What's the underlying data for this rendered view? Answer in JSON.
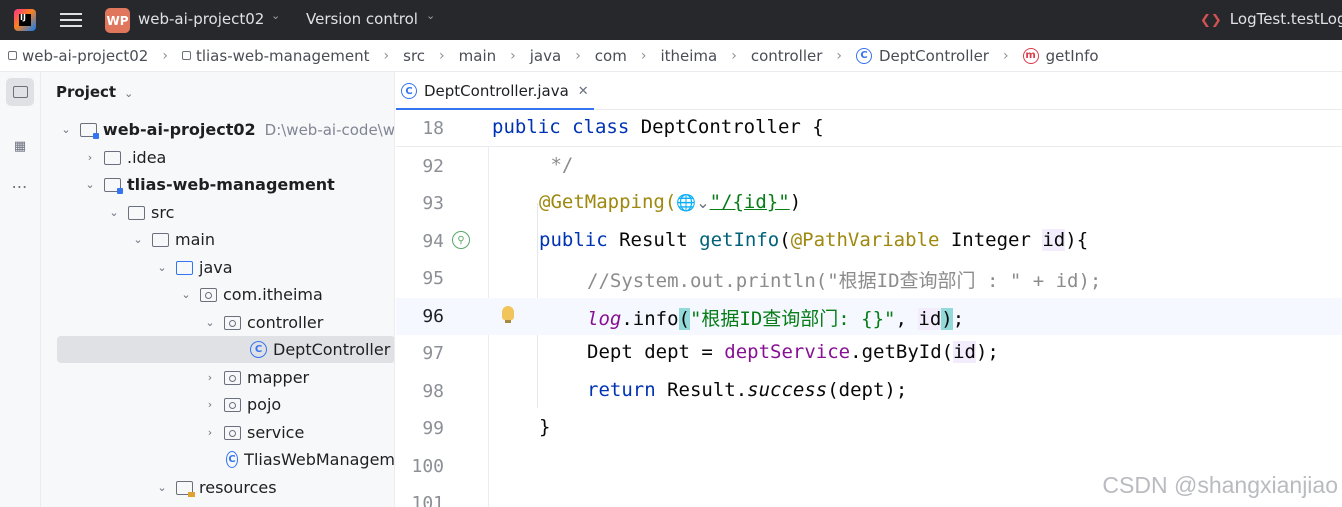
{
  "titlebar": {
    "project_badge": "WP",
    "project_name": "web-ai-project02",
    "vcs_label": "Version control",
    "run_config": "LogTest.testLog"
  },
  "breadcrumb": [
    "web-ai-project02",
    "tlias-web-management",
    "src",
    "main",
    "java",
    "com",
    "itheima",
    "controller",
    "DeptController",
    "getInfo"
  ],
  "project_panel": {
    "title": "Project",
    "tree": [
      {
        "label": "web-ai-project02",
        "hint": "D:\\web-ai-code\\w"
      },
      {
        "label": ".idea"
      },
      {
        "label": "tlias-web-management"
      },
      {
        "label": "src"
      },
      {
        "label": "main"
      },
      {
        "label": "java"
      },
      {
        "label": "com.itheima"
      },
      {
        "label": "controller"
      },
      {
        "label": "DeptController"
      },
      {
        "label": "mapper"
      },
      {
        "label": "pojo"
      },
      {
        "label": "service"
      },
      {
        "label": "TliasWebManagem"
      },
      {
        "label": "resources"
      }
    ]
  },
  "editor": {
    "tab_label": "DeptController.java",
    "lines": [
      "18",
      "92",
      "93",
      "94",
      "95",
      "96",
      "97",
      "98",
      "99",
      "100",
      "101"
    ],
    "code": {
      "l18": {
        "kw": "public class ",
        "name": "DeptController {"
      },
      "l92": " */",
      "l93": {
        "ann": "@GetMapping(",
        "str": "\"/{id}\"",
        "tail": ")"
      },
      "l94": {
        "kw": "public ",
        "type": "Result ",
        "fn": "getInfo",
        "open": "(",
        "ann": "@PathVariable",
        "type2": " Integer ",
        "param": "id",
        "tail": "){"
      },
      "l95": "//System.out.println(\"根据ID查询部门 : \" + id);",
      "l96": {
        "log": "log",
        "dot": ".info",
        "open": "(",
        "str": "\"根据ID查询部门: {}\"",
        "mid": ", ",
        "param": "id",
        "close": ")",
        "semi": ";"
      },
      "l97": {
        "a": "Dept dept = ",
        "fld": "deptService",
        "b": ".getById(",
        "param": "id",
        "c": ");"
      },
      "l98": {
        "kw": "return ",
        "a": "Result.",
        "it": "success",
        "b": "(dept);"
      },
      "l99": "}"
    }
  },
  "watermark": "CSDN @shangxianjiao"
}
